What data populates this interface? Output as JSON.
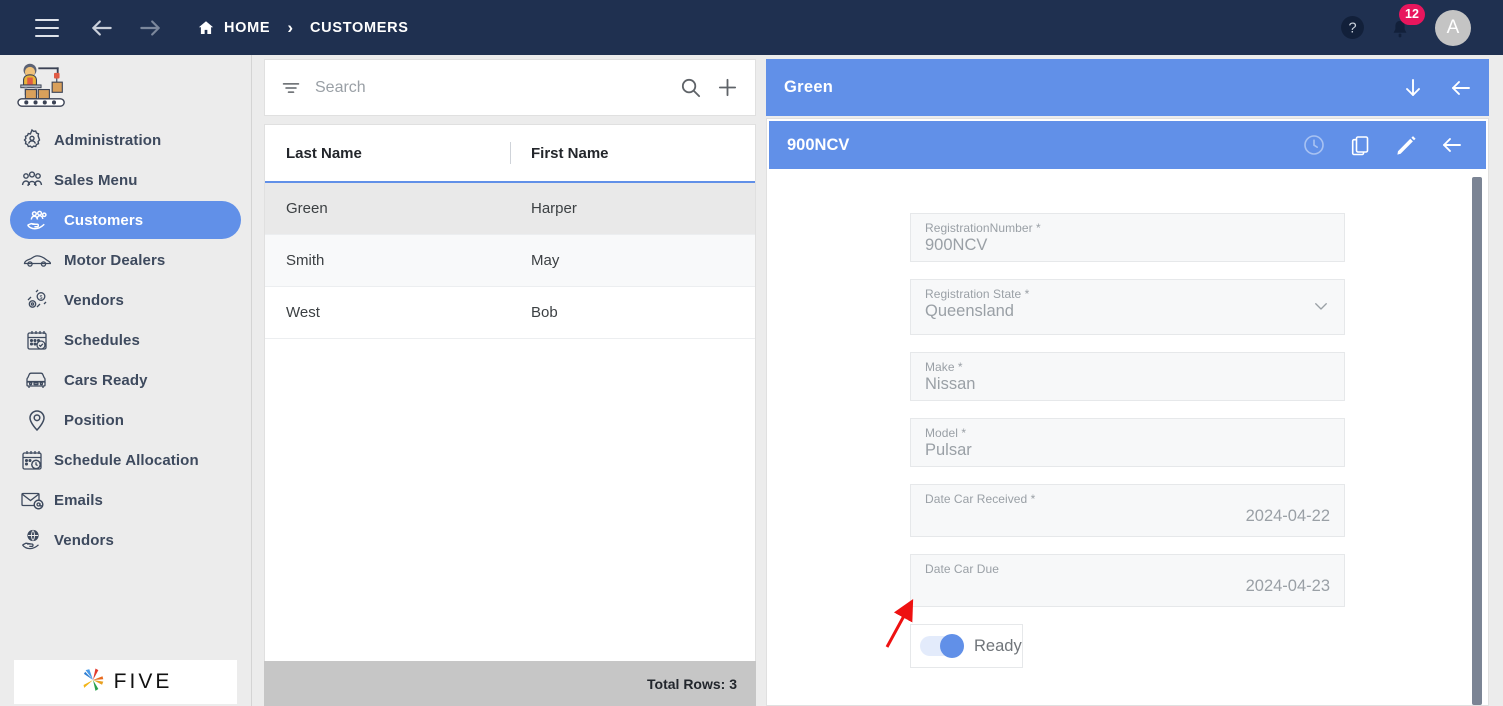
{
  "topbar": {
    "menu_icon": "hamburger-icon",
    "back_icon": "arrow-left-icon",
    "forward_icon": "arrow-right-icon",
    "breadcrumbs": [
      {
        "label": "HOME",
        "icon": "home-icon"
      },
      {
        "label": "CUSTOMERS",
        "icon": ""
      }
    ],
    "separator": "›",
    "help_icon": "help-circle-icon",
    "bell_icon": "bell-icon",
    "notification_count": "12",
    "avatar_initial": "A",
    "background": "#1f3050"
  },
  "sidebar": {
    "logo_icon": "factory-worker-logo-icon",
    "items": [
      {
        "label": "Administration",
        "icon": "gear-user-icon",
        "active": false,
        "indent": false
      },
      {
        "label": "Sales Menu",
        "icon": "people-group-icon",
        "active": false,
        "indent": false
      },
      {
        "label": "Customers",
        "icon": "customers-hand-icon",
        "active": true,
        "indent": true
      },
      {
        "label": "Motor Dealers",
        "icon": "car-side-icon",
        "active": false,
        "indent": true
      },
      {
        "label": "Vendors",
        "icon": "gears-money-icon",
        "active": false,
        "indent": true
      },
      {
        "label": "Schedules",
        "icon": "calendar-check-icon",
        "active": false,
        "indent": true
      },
      {
        "label": "Cars Ready",
        "icon": "car-front-icon",
        "active": false,
        "indent": true
      },
      {
        "label": "Position",
        "icon": "map-pin-icon",
        "active": false,
        "indent": true
      },
      {
        "label": "Schedule Allocation",
        "icon": "calendar-clock-icon",
        "active": false,
        "indent": false
      },
      {
        "label": "Emails",
        "icon": "envelope-at-icon",
        "active": false,
        "indent": false
      },
      {
        "label": "Vendors",
        "icon": "hand-globe-icon",
        "active": false,
        "indent": false
      }
    ],
    "footer_logo_text": "FIVE",
    "active_color": "#6190e8"
  },
  "list_panel": {
    "search": {
      "placeholder": "Search",
      "value": "",
      "filter_icon": "filter-icon",
      "search_icon": "search-icon",
      "add_icon": "plus-icon"
    },
    "columns": [
      "Last Name",
      "First Name"
    ],
    "rows": [
      {
        "last_name": "Green",
        "first_name": "Harper"
      },
      {
        "last_name": "Smith",
        "first_name": "May"
      },
      {
        "last_name": "West",
        "first_name": "Bob"
      }
    ],
    "footer_text": "Total Rows: 3"
  },
  "detail_panel": {
    "outer_title": "Green",
    "outer_actions": [
      {
        "icon": "arrow-down-icon",
        "name": "download-button"
      },
      {
        "icon": "arrow-left-icon",
        "name": "close-outer-button"
      }
    ],
    "inner_title": "900NCV",
    "inner_actions": [
      {
        "icon": "clock-history-icon",
        "name": "history-button"
      },
      {
        "icon": "copy-icon",
        "name": "duplicate-button"
      },
      {
        "icon": "pencil-icon",
        "name": "edit-button"
      },
      {
        "icon": "arrow-left-icon",
        "name": "close-inner-button"
      }
    ],
    "fields": [
      {
        "label": "RegistrationNumber *",
        "value": "900NCV",
        "type": "text",
        "align": "left"
      },
      {
        "label": "Registration State *",
        "value": "Queensland",
        "type": "select",
        "align": "left"
      },
      {
        "label": "Make *",
        "value": "Nissan",
        "type": "text",
        "align": "left"
      },
      {
        "label": "Model *",
        "value": "Pulsar",
        "type": "text",
        "align": "left"
      },
      {
        "label": "Date Car Received *",
        "value": "2024-04-22",
        "type": "date",
        "align": "right"
      },
      {
        "label": "Date Car Due",
        "value": "2024-04-23",
        "type": "date",
        "align": "right"
      }
    ],
    "toggle": {
      "label": "Ready",
      "checked": true
    },
    "header_color": "#6190e8"
  },
  "annotation": {
    "arrow_color": "#ee1111",
    "points_to": "ready-toggle"
  }
}
